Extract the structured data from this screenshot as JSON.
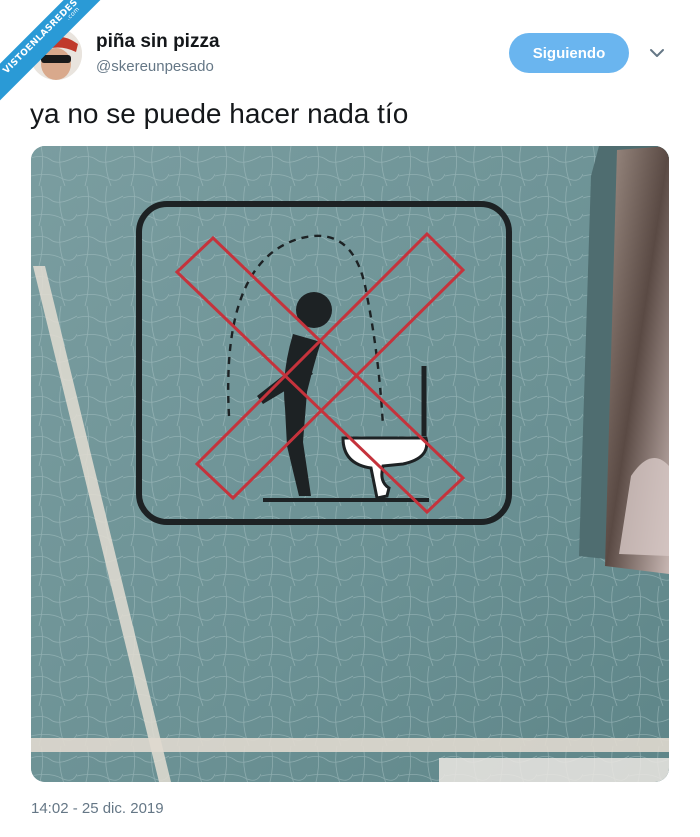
{
  "watermark": {
    "text": "VISTOENLASREDES",
    "suffix": ".com"
  },
  "tweet": {
    "author_name": "piña sin pizza",
    "author_handle": "@skereunpesado",
    "follow_label": "Siguiendo",
    "text": "ya no se puede hacer nada tío",
    "timestamp": "14:02 - 25 dic. 2019"
  },
  "icons": {
    "more": "chevron-down-icon",
    "sign": "no-standing-urination-sign"
  },
  "colors": {
    "follow_button": "#6ab5ef",
    "ribbon": "#2a9ad6",
    "secondary_text": "#657786",
    "wall": "#6d9295",
    "red_cross": "#c5333c"
  }
}
